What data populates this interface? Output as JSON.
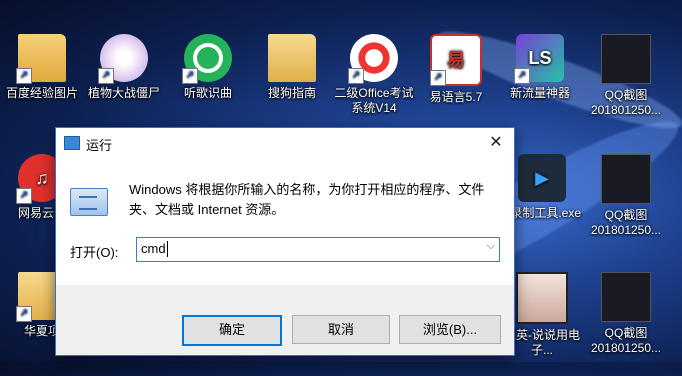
{
  "desktop": {
    "icons": [
      {
        "label": "百度经验图片",
        "icon": "folder-icon"
      },
      {
        "label": "植物大战僵尸",
        "icon": "plants-vs-zombies-icon"
      },
      {
        "label": "听歌识曲",
        "icon": "music-recognition-icon"
      },
      {
        "label": "搜狗指南",
        "icon": "folder-icon"
      },
      {
        "label": "二级Office考试系统V14",
        "icon": "exam-system-icon"
      },
      {
        "label": "易语言5.7",
        "icon": "easy-language-icon"
      },
      {
        "label": "新流量神器",
        "icon": "traffic-tool-icon"
      },
      {
        "label": "QQ截图201801250...",
        "icon": "screenshot-image-icon"
      },
      {
        "label": "网易云音",
        "icon": "netease-music-icon"
      },
      {
        "label": "F录制工具.exe",
        "icon": "recorder-icon"
      },
      {
        "label": "QQ截图201801250...",
        "icon": "screenshot-image-icon"
      },
      {
        "label": "华夏项",
        "icon": "document-icon"
      },
      {
        "label": "忠英-说说用电子...",
        "icon": "video-file-icon"
      },
      {
        "label": "QQ截图201801250...",
        "icon": "screenshot-image-icon"
      }
    ]
  },
  "run_dialog": {
    "title": "运行",
    "close_symbol": "✕",
    "description": "Windows 将根据你所输入的名称，为你打开相应的程序、文件夹、文档或 Internet 资源。",
    "open_label": "打开(O):",
    "input_value": "cmd",
    "dropdown_symbol": "⌵",
    "buttons": {
      "ok": "确定",
      "cancel": "取消",
      "browse": "浏览(B)..."
    }
  }
}
